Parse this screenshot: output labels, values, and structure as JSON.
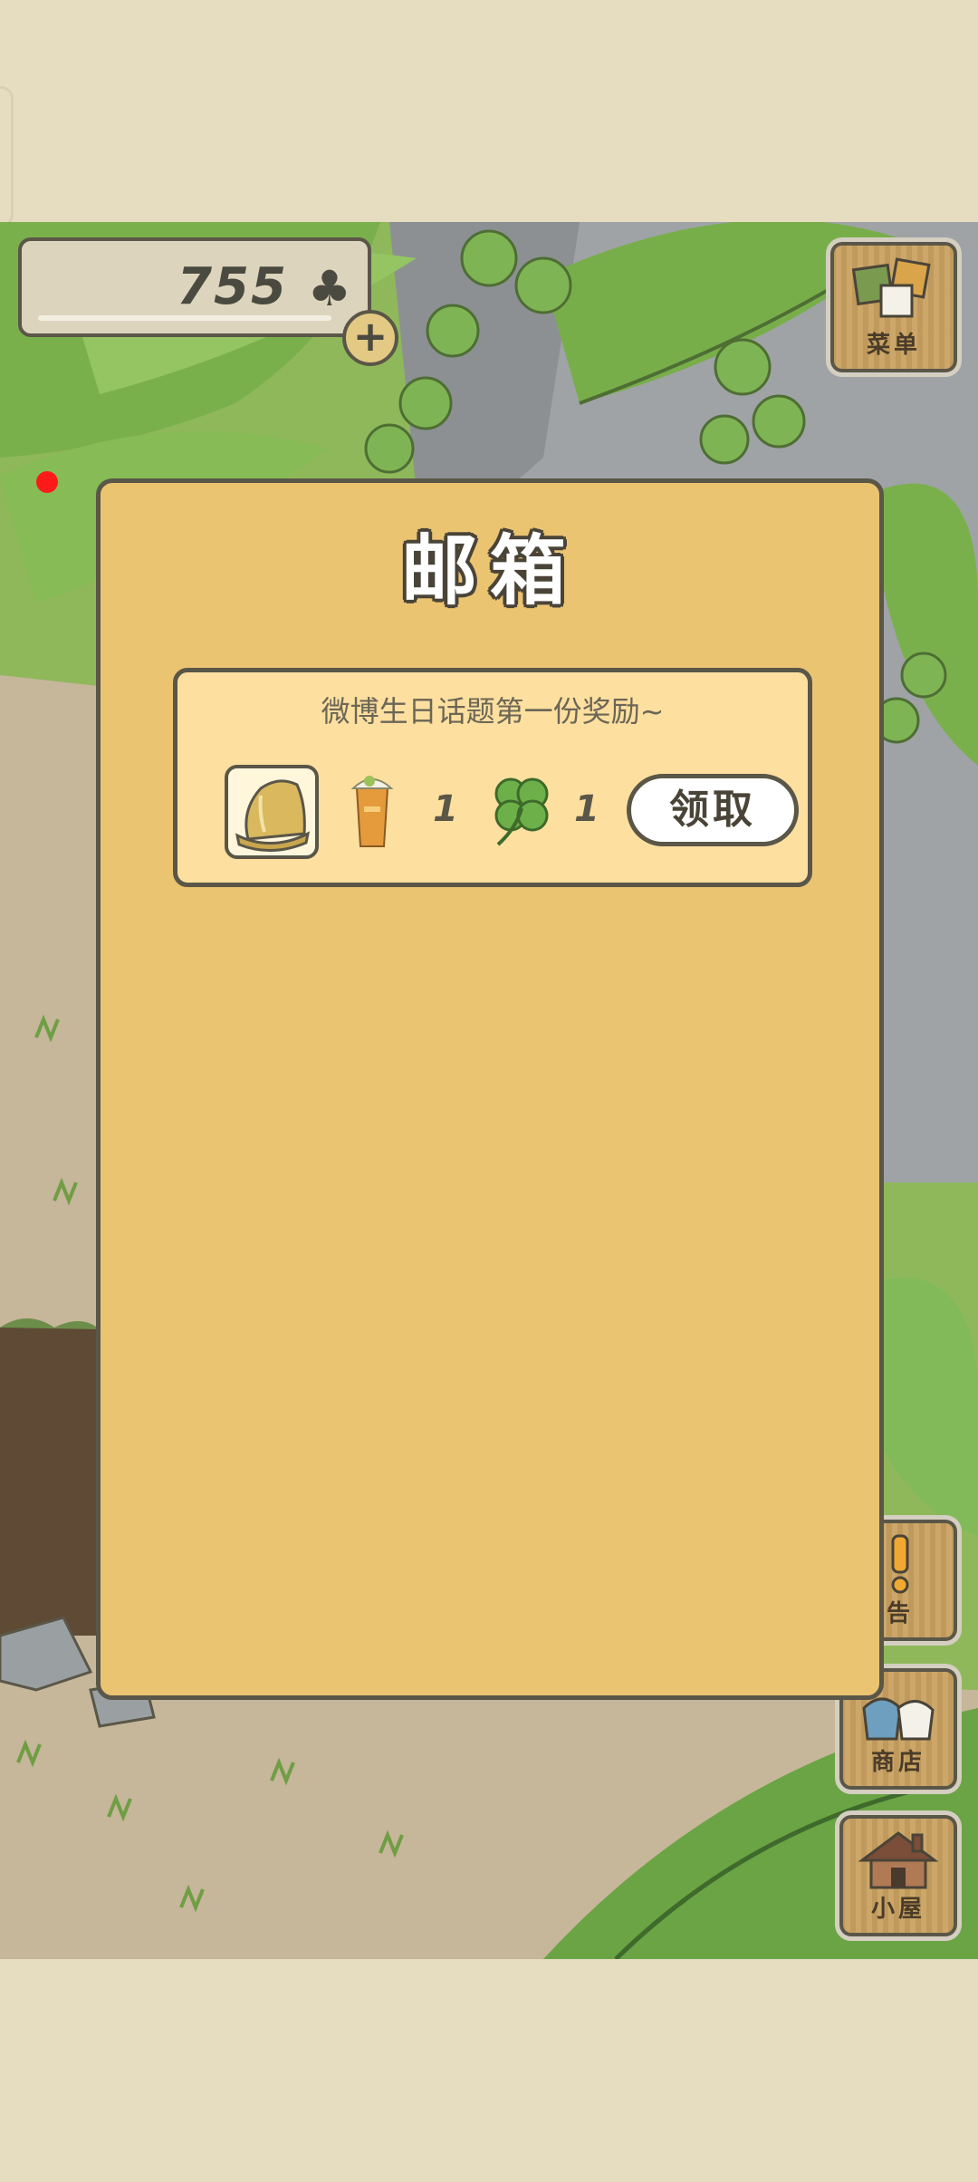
{
  "clover_counter": {
    "value": "755"
  },
  "menu_button": {
    "label": "菜单"
  },
  "mailbox": {
    "title": "邮箱",
    "items": [
      {
        "subject": "微博生日话题第一份奖励~",
        "reward_drink_count": "1",
        "reward_clover_count": "1",
        "claim_label": "领取"
      }
    ]
  },
  "side_buttons": {
    "notice_label": "告",
    "shop_label": "商店",
    "house_label": "小屋"
  },
  "colors": {
    "panel": "#ebc472",
    "mail_card": "#fddf9f",
    "outline": "#5a5648",
    "notification_dot": "#ff1a1a"
  }
}
